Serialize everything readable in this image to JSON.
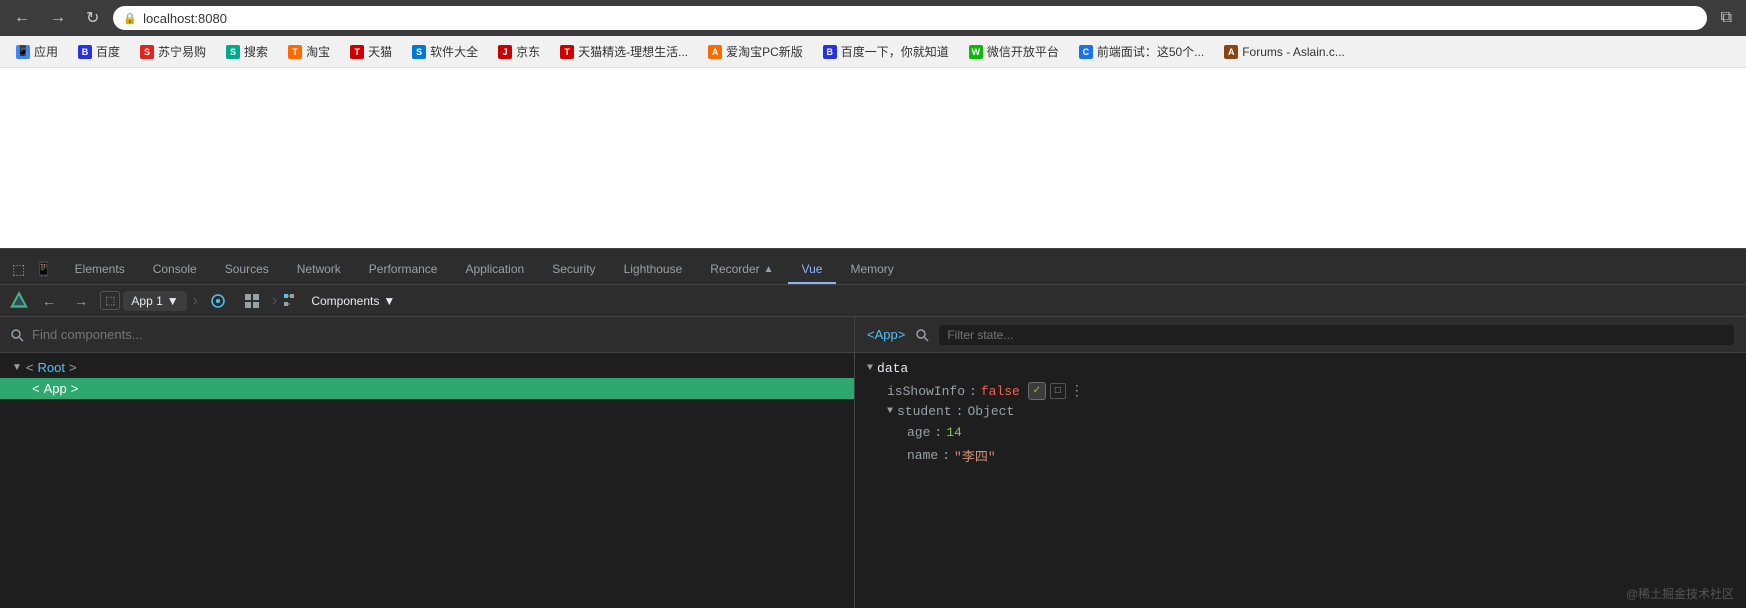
{
  "browser": {
    "url": "localhost:8080",
    "back_label": "←",
    "forward_label": "→",
    "refresh_label": "↻",
    "external_label": "⧉"
  },
  "bookmarks": [
    {
      "icon": "📱",
      "label": "应用"
    },
    {
      "icon": "B",
      "label": "百度"
    },
    {
      "icon": "S",
      "label": "苏宁易购"
    },
    {
      "icon": "S",
      "label": "搜索"
    },
    {
      "icon": "T",
      "label": "淘宝"
    },
    {
      "icon": "T",
      "label": "天猫"
    },
    {
      "icon": "S",
      "label": "软件大全"
    },
    {
      "icon": "J",
      "label": "京东"
    },
    {
      "icon": "T",
      "label": "天猫精选-理想生活..."
    },
    {
      "icon": "A",
      "label": "爱淘宝PC新版"
    },
    {
      "icon": "B",
      "label": "百度一下，你就知道"
    },
    {
      "icon": "W",
      "label": "微信开放平台"
    },
    {
      "icon": "C",
      "label": "前端面试：这50个..."
    },
    {
      "icon": "A",
      "label": "Forums - Aslain.c..."
    }
  ],
  "devtools": {
    "tabs": [
      {
        "label": "Elements",
        "active": false
      },
      {
        "label": "Console",
        "active": false
      },
      {
        "label": "Sources",
        "active": false
      },
      {
        "label": "Network",
        "active": false
      },
      {
        "label": "Performance",
        "active": false
      },
      {
        "label": "Application",
        "active": false
      },
      {
        "label": "Security",
        "active": false
      },
      {
        "label": "Lighthouse",
        "active": false
      },
      {
        "label": "Recorder",
        "active": false
      },
      {
        "label": "Vue",
        "active": true
      },
      {
        "label": "Memory",
        "active": false
      }
    ],
    "toolbar": {
      "app_label": "App 1",
      "components_label": "Components"
    },
    "left": {
      "search_placeholder": "Find components...",
      "tree": [
        {
          "label": "<Root>",
          "indent": 0,
          "arrow": "▼",
          "selected": false
        },
        {
          "label": "<App>",
          "indent": 1,
          "arrow": "",
          "selected": true
        }
      ]
    },
    "right": {
      "app_tag": "<App>",
      "filter_placeholder": "Filter state...",
      "data_label": "data",
      "isShowInfo": {
        "key": "isShowInfo",
        "value": "false"
      },
      "student": {
        "key": "student",
        "type": "Object",
        "age": {
          "key": "age",
          "value": "14"
        },
        "name": {
          "key": "name",
          "value": "\"李四\""
        }
      }
    },
    "watermark": "@稀土掘金技术社区"
  }
}
